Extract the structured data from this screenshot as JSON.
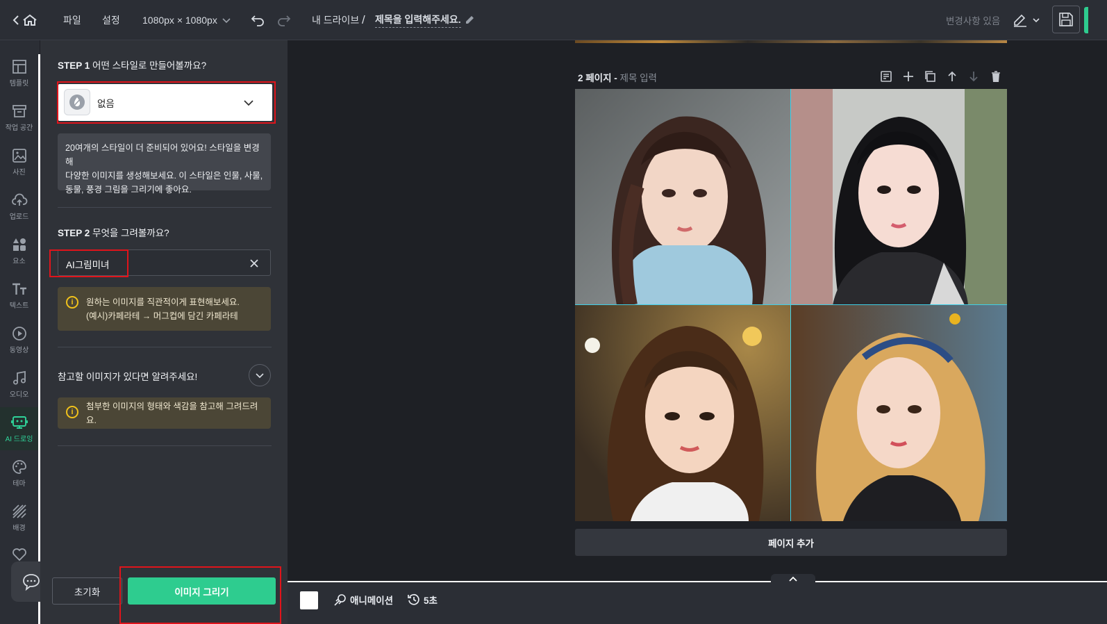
{
  "topbar": {
    "menu_file": "파일",
    "menu_settings": "설정",
    "canvas_size": "1080px × 1080px",
    "breadcrumb_drive": "내 드라이브",
    "breadcrumb_separator": "/",
    "doc_title": "제목을 입력해주세요.",
    "status": "변경사항 있음"
  },
  "sidebar": {
    "items": [
      {
        "label": "템플릿",
        "icon": "template-icon"
      },
      {
        "label": "작업 공간",
        "icon": "workspace-icon"
      },
      {
        "label": "사진",
        "icon": "photo-icon"
      },
      {
        "label": "업로드",
        "icon": "upload-icon"
      },
      {
        "label": "요소",
        "icon": "elements-icon"
      },
      {
        "label": "텍스트",
        "icon": "text-icon"
      },
      {
        "label": "동영상",
        "icon": "video-icon"
      },
      {
        "label": "오디오",
        "icon": "audio-icon"
      },
      {
        "label": "AI 드로잉",
        "icon": "ai-drawing-icon",
        "active": true
      },
      {
        "label": "테마",
        "icon": "palette-icon"
      },
      {
        "label": "배경",
        "icon": "background-icon"
      }
    ]
  },
  "panel": {
    "step1_num": "STEP 1",
    "step1_text": "어떤 스타일로 만들어볼까요?",
    "style_value": "없음",
    "style_desc_lines": [
      "20여개의 스타일이 더 준비되어 있어요! 스타일을 변경해",
      "다양한 이미지를 생성해보세요. 이 스타일은 인물, 사물,",
      "동물, 풍경 그림을 그리기에 좋아요."
    ],
    "step2_num": "STEP 2",
    "step2_text": "무엇을 그려볼까요?",
    "prompt_value": "AI그림미녀",
    "tip1_lines": [
      "원하는 이미지를 직관적이게 표현해보세요.",
      "(예시)카페라테 → 머그컵에 담긴 카페라테"
    ],
    "reference_label": "참고할 이미지가 있다면 알려주세요!",
    "tip2": "첨부한 이미지의 형태와 색감을 참고해 그려드려요.",
    "reset_label": "초기화",
    "draw_label": "이미지 그리기"
  },
  "canvas": {
    "page_label": "2 페이지 -",
    "page_title_placeholder": "제목 입력",
    "add_page_label": "페이지 추가"
  },
  "bottombar": {
    "animation_label": "애니메이션",
    "duration_label": "5초"
  },
  "colors": {
    "accent": "#2ecc8f",
    "highlight": "#e0141b",
    "selection": "#3fd0e8"
  }
}
